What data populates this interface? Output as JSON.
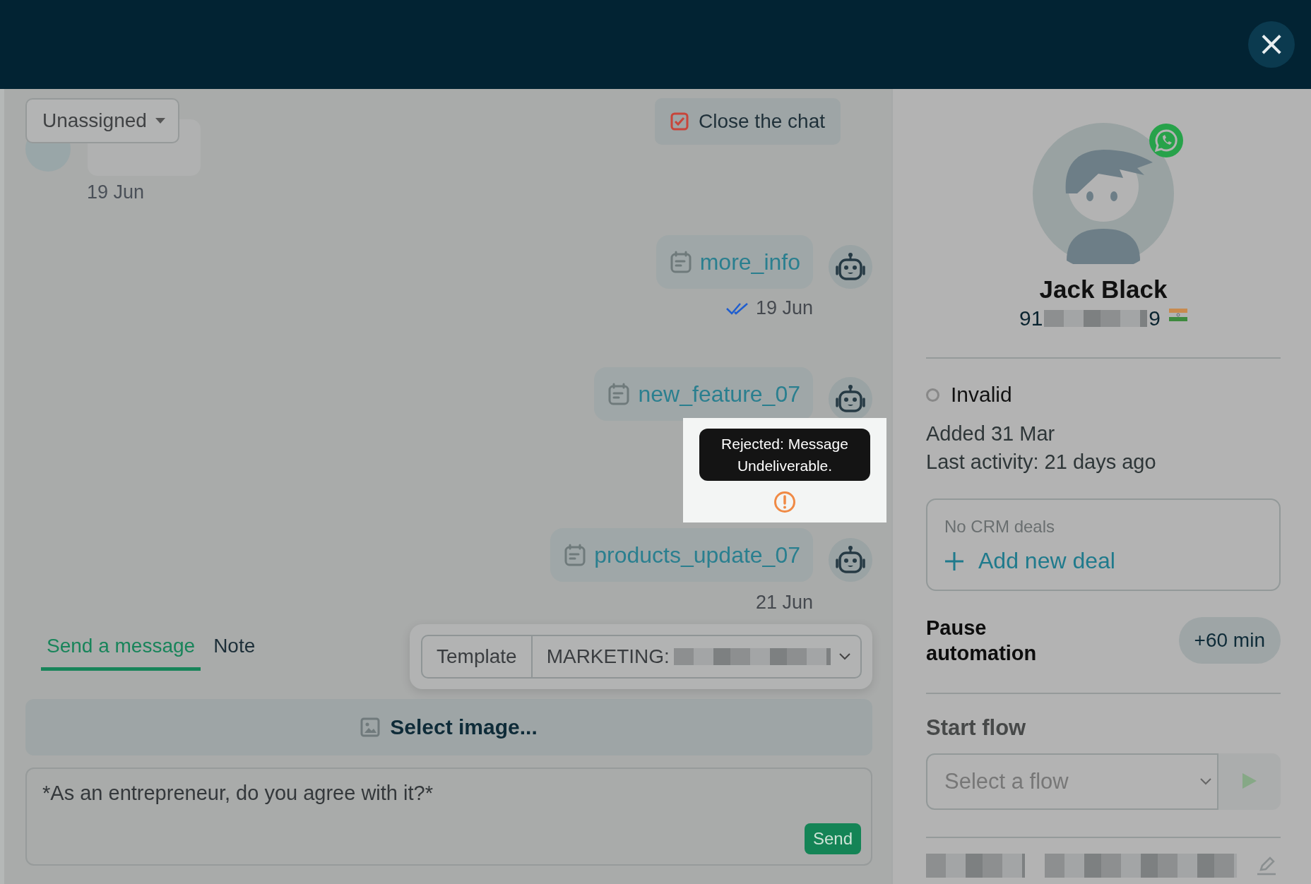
{
  "header": {
    "close_label": "×"
  },
  "chat": {
    "assignee": "Unassigned",
    "close_chat": "Close the chat",
    "incoming": {
      "date": "19 Jun"
    },
    "messages": [
      {
        "template": "more_info",
        "date": "19 Jun",
        "kind": "read"
      },
      {
        "template": "new_feature_07",
        "kind": "rejected",
        "tooltip": "Rejected: Message Undeliverable."
      },
      {
        "template": "products_update_07",
        "date": "21 Jun",
        "kind": "plain"
      }
    ],
    "tabs": [
      {
        "label": "Send a message",
        "selected": true
      },
      {
        "label": "Note",
        "selected": false
      }
    ],
    "template_picker": {
      "label": "Template",
      "value": "MARKETING:"
    },
    "select_image": "Select image...",
    "message_text": "*As an entrepreneur, do you agree with it?*",
    "send": "Send"
  },
  "contact": {
    "name": "Jack Black",
    "phone_start": "91",
    "phone_end": "9",
    "status": "Invalid",
    "added": "Added 31 Mar",
    "last_activity": "Last activity: 21 days ago",
    "deals": {
      "empty": "No CRM deals",
      "add": "Add new deal"
    },
    "pause": {
      "label": "Pause automation",
      "button": "+60 min"
    },
    "flow": {
      "title": "Start flow",
      "placeholder": "Select a flow"
    }
  }
}
